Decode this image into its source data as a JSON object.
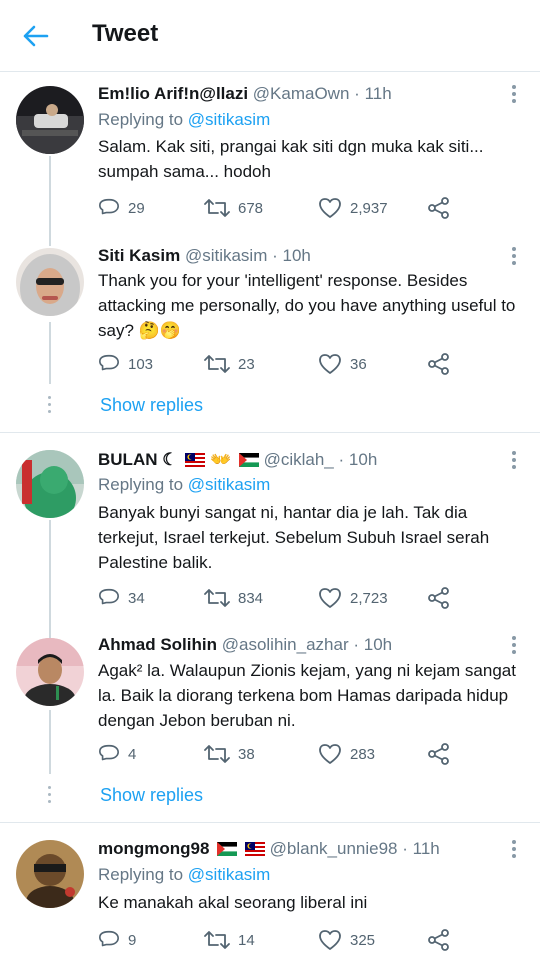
{
  "header": {
    "title": "Tweet",
    "back_icon": "arrow-left-icon",
    "accent": "#1da1f2"
  },
  "tweets": [
    {
      "name": "Em!lio Arif!n@llazi",
      "handle": "@KamaOwn",
      "dot": "·",
      "time": "11h",
      "replying_label": "Replying to",
      "replying_to": "@sitikasim",
      "text": "Salam. Kak siti, prangai kak siti dgn muka kak siti... sumpah sama... hodoh",
      "replies": "29",
      "retweets": "678",
      "likes": "2,937"
    },
    {
      "name": "Siti Kasim",
      "handle": "@sitikasim",
      "dot": "·",
      "time": "10h",
      "text": "Thank you for your 'intelligent' response.  Besides attacking me personally, do you have anything useful to say? 🤔🤭",
      "replies": "103",
      "retweets": "23",
      "likes": "36",
      "show_replies": "Show replies"
    },
    {
      "name": "BULAN ☾",
      "name_emoji": "👐",
      "handle": "@ciklah_",
      "dot": "·",
      "time": "10h",
      "replying_label": "Replying to",
      "replying_to": "@sitikasim",
      "text": "Banyak bunyi sangat ni, hantar dia je lah. Tak dia terkejut, Israel terkejut. Sebelum Subuh Israel serah Palestine balik.",
      "replies": "34",
      "retweets": "834",
      "likes": "2,723"
    },
    {
      "name": "Ahmad Solihin",
      "handle": "@asolihin_azhar",
      "dot": "·",
      "time": "10h",
      "text": "Agak² la. Walaupun Zionis kejam, yang ni kejam sangat la. Baik la diorang terkena bom Hamas daripada hidup dengan Jebon beruban ni.",
      "replies": "4",
      "retweets": "38",
      "likes": "283",
      "show_replies": "Show replies"
    },
    {
      "name": "mongmong98",
      "handle": "@blank_unnie98",
      "dot": "·",
      "time": "11h",
      "replying_label": "Replying to",
      "replying_to": "@sitikasim",
      "text": "Ke manakah akal seorang liberal ini",
      "replies": "9",
      "retweets": "14",
      "likes": "325"
    }
  ],
  "icons": {
    "reply": "reply-icon",
    "retweet": "retweet-icon",
    "like": "heart-icon",
    "share": "share-icon",
    "more": "more-options-icon"
  }
}
